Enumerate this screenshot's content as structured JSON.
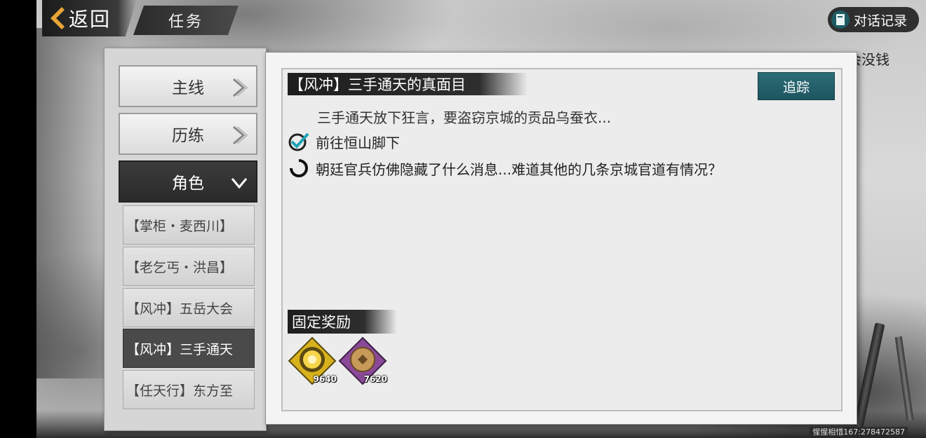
{
  "topbar": {
    "back_label": "返回",
    "title": "任务",
    "dialog_label": "对话记录"
  },
  "marquee": "张：教你去打六扇门永远不会没钱",
  "categories": [
    {
      "label": "主线",
      "state": "collapsed"
    },
    {
      "label": "历练",
      "state": "collapsed"
    },
    {
      "label": "角色",
      "state": "expanded"
    }
  ],
  "subitems": [
    {
      "label": "【掌柜・麦西川】",
      "selected": false
    },
    {
      "label": "【老乞丐・洪昌】",
      "selected": false
    },
    {
      "label": "【风冲】五岳大会",
      "selected": false
    },
    {
      "label": "【风冲】三手通天",
      "selected": true
    },
    {
      "label": "【任天行】东方至",
      "selected": false
    }
  ],
  "quest": {
    "title": "【风冲】三手通天的真面目",
    "track_label": "追踪",
    "description": "三手通天放下狂言，要盗窃京城的贡品乌蚕衣...",
    "objectives": [
      {
        "text": "前往恒山脚下",
        "status": "completed",
        "icon": "check-icon"
      },
      {
        "text": "朝廷官兵仿佛隐藏了什么消息...难道其他的几条京城官道有情况？",
        "status": "in-progress",
        "icon": "progress-ring-icon"
      }
    ]
  },
  "rewards": {
    "title": "固定奖励",
    "items": [
      {
        "icon": "gold-experience-icon",
        "count": "9640",
        "color": "#d8b21c"
      },
      {
        "icon": "copper-coin-icon",
        "count": "7620",
        "color": "#8a4a98"
      }
    ]
  },
  "footer": "惺惺相惜167:278472587",
  "colors": {
    "accent": "#1e5560",
    "dark_panel": "#2a2a2a"
  }
}
